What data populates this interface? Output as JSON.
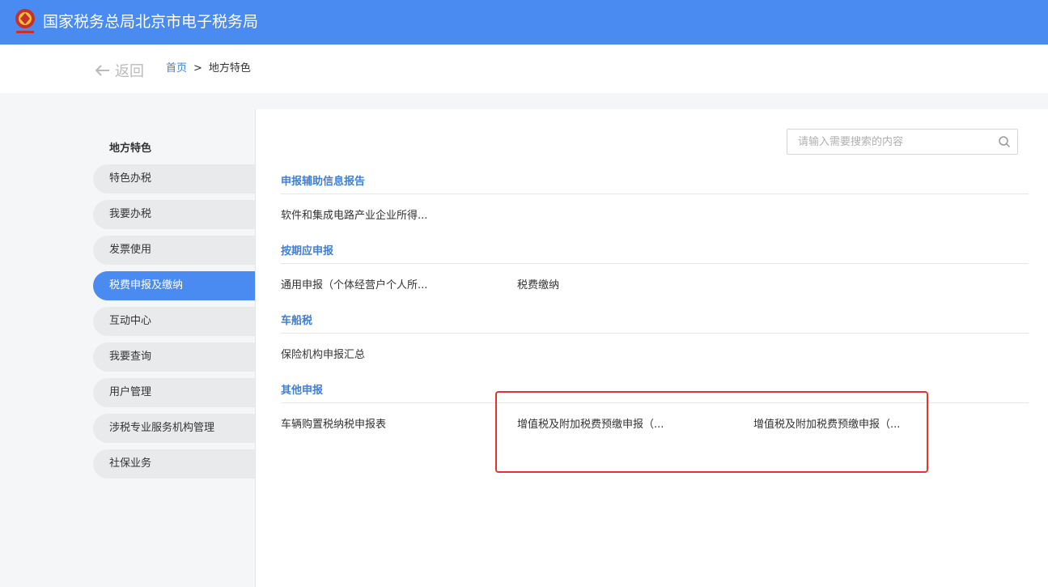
{
  "header": {
    "title": "国家税务总局北京市电子税务局"
  },
  "nav": {
    "back_label": "返回",
    "breadcrumb_home": "首页",
    "breadcrumb_sep": ">",
    "breadcrumb_current": "地方特色"
  },
  "sidebar": {
    "title": "地方特色",
    "items": [
      {
        "label": "特色办税"
      },
      {
        "label": "我要办税"
      },
      {
        "label": "发票使用"
      },
      {
        "label": "税费申报及缴纳"
      },
      {
        "label": "互动中心"
      },
      {
        "label": "我要查询"
      },
      {
        "label": "用户管理"
      },
      {
        "label": "涉税专业服务机构管理"
      },
      {
        "label": "社保业务"
      }
    ],
    "active_index": 3
  },
  "search": {
    "placeholder": "请输入需要搜索的内容"
  },
  "sections": [
    {
      "title": "申报辅助信息报告",
      "entries": [
        "软件和集成电路产业企业所得..."
      ]
    },
    {
      "title": "按期应申报",
      "entries": [
        "通用申报（个体经营户个人所...",
        "税费缴纳"
      ]
    },
    {
      "title": "车船税",
      "entries": [
        "保险机构申报汇总"
      ]
    },
    {
      "title": "其他申报",
      "entries": [
        "车辆购置税纳税申报表",
        "增值税及附加税费预缴申报（...",
        "增值税及附加税费预缴申报（..."
      ]
    }
  ],
  "colors": {
    "topbar": "#4a8bf2",
    "accent": "#3f7fd6",
    "highlight": "#e8322e"
  }
}
